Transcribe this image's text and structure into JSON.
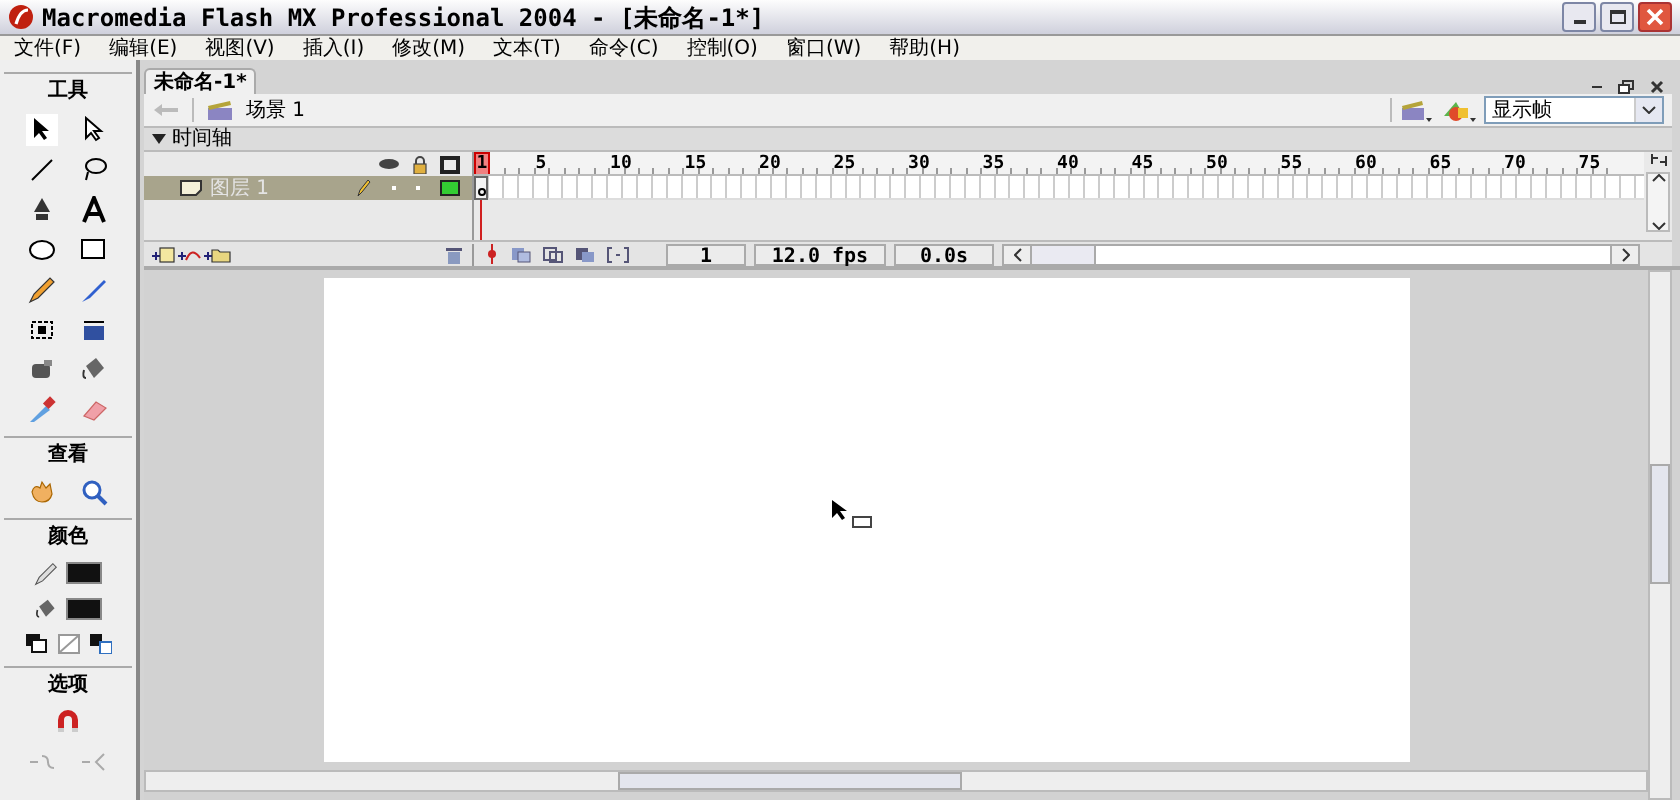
{
  "window": {
    "title": "Macromedia Flash MX Professional 2004 - [未命名-1*]"
  },
  "menu": [
    "文件(F)",
    "编辑(E)",
    "视图(V)",
    "插入(I)",
    "修改(M)",
    "文本(T)",
    "命令(C)",
    "控制(O)",
    "窗口(W)",
    "帮助(H)"
  ],
  "toolbox": {
    "sections": [
      "工具",
      "查看",
      "颜色",
      "选项"
    ]
  },
  "document_tab": {
    "label": "未命名-1*",
    "selected": true
  },
  "scene": {
    "label": "场景 1"
  },
  "view_dropdown": {
    "value": "显示帧"
  },
  "timeline": {
    "label": "时间轴",
    "expanded": true,
    "ruler": [
      "1",
      "5",
      "10",
      "15",
      "20",
      "25",
      "30",
      "35",
      "40",
      "45",
      "50",
      "55",
      "60",
      "65",
      "70",
      "75"
    ],
    "layers": [
      {
        "name": "图层 1",
        "selected": true,
        "color": "#33cc33"
      }
    ],
    "current_frame": "1",
    "frame_rate": "12.0 fps",
    "elapsed_time": "0.0s"
  }
}
